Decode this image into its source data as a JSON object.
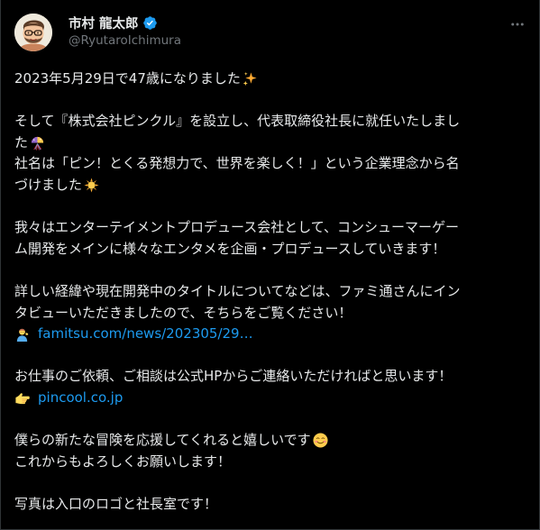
{
  "author": {
    "display_name": "市村 龍太郎",
    "handle": "@RyutaroIchimura"
  },
  "tweet": {
    "line_1": "2023年5月29日で47歳になりました",
    "line_2": "そして『株式会社ピンクル』を設立し、代表取締役社長に就任いたしまし",
    "line_3": "た",
    "line_4": "社名は「ピン！とくる発想力で、世界を楽しく！」という企業理念から名",
    "line_5": "づけました",
    "line_6": "我々はエンターテイメントプロデュース会社として、コンシューマーゲー",
    "line_7": "ム開発をメインに様々なエンタメを企画・プロデュースしていきます！",
    "line_8": "詳しい経緯や現在開発中のタイトルについてなどは、ファミ通さんにイン",
    "line_9": "タビューいただきましたので、そちらをご覧ください！",
    "link_1": "famitsu.com/news/202305/29…",
    "line_10": "お仕事のご依頼、ご相談は公式HPからご連絡いただければと思います！",
    "link_2": "pincool.co.jp",
    "line_11": "僕らの新たな冒険を応援してくれると嬉しいです",
    "line_12": "これからもよろしくお願いします！",
    "line_13": "写真は入口のロゴと社長室です！"
  },
  "icons": {
    "verified": "verified-badge-icon",
    "more": "more-options-icon",
    "sparkles": "sparkles-emoji",
    "confetti": "confetti-ball-emoji",
    "sun": "sun-emoji",
    "person_pointing": "person-tipping-hand-emoji",
    "pointing_hand": "backhand-index-pointing-right-emoji",
    "smile": "smiling-face-emoji"
  },
  "colors": {
    "background": "#000000",
    "text": "#e7e9ea",
    "secondary_text": "#71767b",
    "link": "#1d9bf0",
    "verified": "#1d9bf0",
    "border": "#2f3336"
  }
}
